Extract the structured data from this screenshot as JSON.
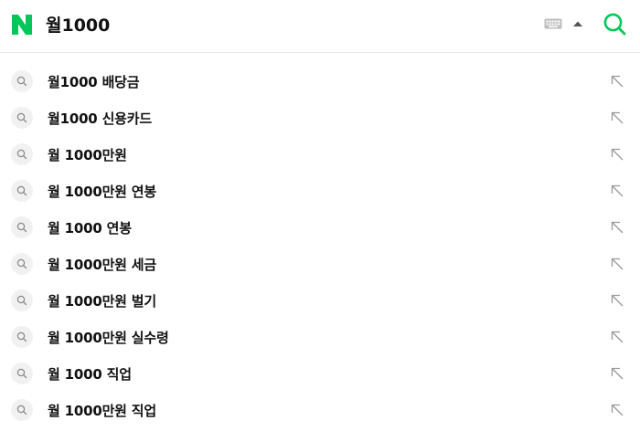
{
  "search": {
    "query": "월1000"
  },
  "icons": {
    "logo": "naver-n-logo",
    "keyboard": "keyboard-icon",
    "dropdown": "caret-up-icon",
    "search": "search-icon",
    "suggestion": "magnifier-icon",
    "fill": "arrow-up-left-icon"
  },
  "colors": {
    "brand": "#03c75a",
    "icon_gray": "#a7a7a7",
    "text": "#111111"
  },
  "suggestions": [
    {
      "label": "월1000 배당금"
    },
    {
      "label": "월1000 신용카드"
    },
    {
      "label": "월 1000만원"
    },
    {
      "label": "월 1000만원 연봉"
    },
    {
      "label": "월 1000 연봉"
    },
    {
      "label": "월 1000만원 세금"
    },
    {
      "label": "월 1000만원 벌기"
    },
    {
      "label": "월 1000만원 실수령"
    },
    {
      "label": "월 1000 직업"
    },
    {
      "label": "월 1000만원 직업"
    }
  ]
}
